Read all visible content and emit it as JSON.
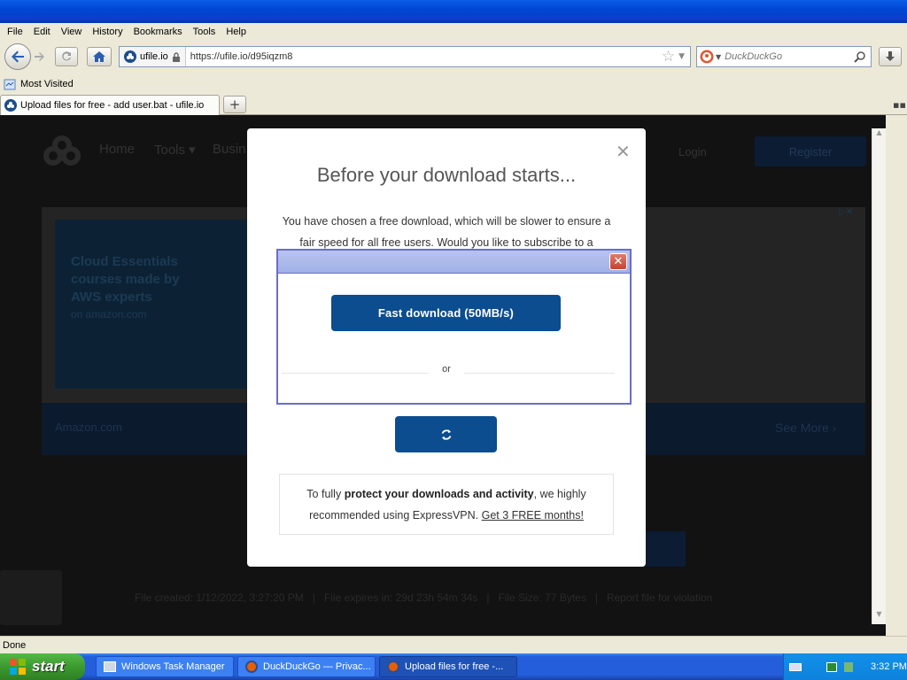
{
  "menubar": {
    "items": [
      "File",
      "Edit",
      "View",
      "History",
      "Bookmarks",
      "Tools",
      "Help"
    ]
  },
  "navbar": {
    "site_identity": "ufile.io",
    "url": "https://ufile.io/d95iqzm8",
    "search_placeholder": "DuckDuckGo"
  },
  "bookmarks": {
    "most_visited": "Most Visited"
  },
  "tab": {
    "title": "Upload files for free - add user.bat - ufile.io"
  },
  "page": {
    "nav": [
      "Home",
      "Tools ▾",
      "Busin"
    ],
    "login": "Login",
    "register": "Register",
    "ad_title": "Cloud Essentials courses made by AWS experts",
    "ad_sub": "on amazon.com",
    "ad_footer": "Amazon.com",
    "see_more": "See More  ›",
    "footer_info": "File created: 1/12/2022, 3:27:20 PM   |   File expires in: 29d 23h 54m 34s   |   File Size: 77 Bytes   |   Report file for violation"
  },
  "modal": {
    "title": "Before your download starts...",
    "text": "You have chosen a free download, which will be slower to ensure a fair speed for all free users. Would you like to subscribe to a",
    "vpn_pre": "To fully ",
    "vpn_bold": "protect your downloads and activity",
    "vpn_mid": ", we highly recommended using ExpressVPN. ",
    "vpn_link": "Get 3 FREE months!"
  },
  "popup": {
    "fast_download": "Fast download (50MB/s)",
    "or": "or"
  },
  "status": {
    "text": "Done"
  },
  "taskbar": {
    "start": "start",
    "tasks": [
      "Windows Task Manager",
      "DuckDuckGo — Privac...",
      "Upload files for free -..."
    ],
    "clock": "3:32 PM"
  },
  "colors": {
    "primary_button": "#0b4d8f",
    "popup_border": "#6a6dcc",
    "xp_taskbar": "#245edb"
  }
}
